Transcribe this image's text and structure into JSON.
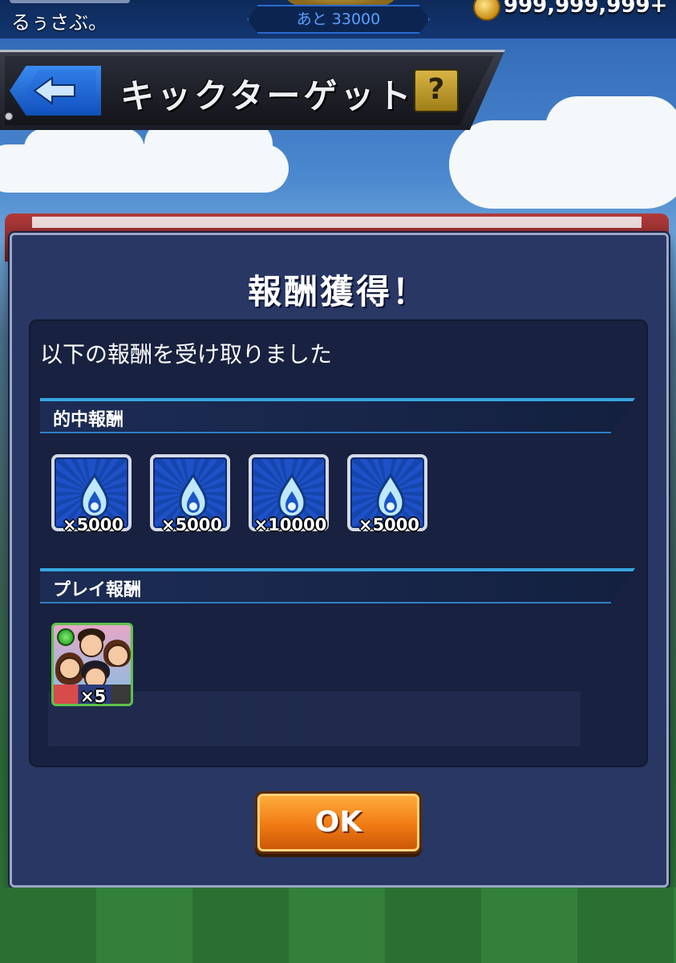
{
  "status_bar": {
    "user_name": "るぅさぶ。",
    "exp_remaining": "あと 33000",
    "coins": "999,999,999+"
  },
  "header": {
    "title": "キックターゲット",
    "help_label": "?"
  },
  "dialog": {
    "title": "報酬獲得！",
    "message": "以下の報酬を受け取りました",
    "hit_rewards": {
      "label": "的中報酬",
      "items": [
        {
          "qty": "×5000",
          "icon": "flame-icon"
        },
        {
          "qty": "×5000",
          "icon": "flame-icon"
        },
        {
          "qty": "×10000",
          "icon": "flame-icon"
        },
        {
          "qty": "×5000",
          "icon": "flame-icon"
        }
      ]
    },
    "play_rewards": {
      "label": "プレイ報酬",
      "items": [
        {
          "qty": "×5",
          "icon": "character-card-icon"
        }
      ]
    },
    "ok_label": "OK"
  },
  "colors": {
    "dialog_bg": "#283763",
    "accent_cyan": "#37a6e0",
    "ok_orange": "#f07a12",
    "back_blue": "#1f66d8"
  }
}
